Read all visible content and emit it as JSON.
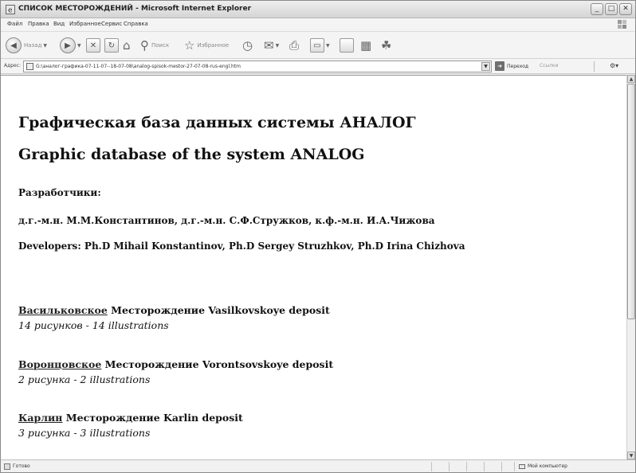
{
  "window": {
    "title": "СПИСОК МЕСТОРОЖДЕНИЙ - Microsoft Internet Explorer"
  },
  "menu": {
    "items": [
      "Файл",
      "Правка",
      "Вид",
      "Избранное",
      "Сервис",
      "Справка"
    ]
  },
  "toolbar": {
    "back_label": "Назад",
    "search_label": "Поиск",
    "favorites_label": "Избранное"
  },
  "address": {
    "label": "Адрес:",
    "url": "G:\\аналог-графика-07-11-07--18-07-08\\analog-spisok-mestor-27-07-08-rus-engl.htm",
    "go_label": "Переход",
    "links_label": "Ссылки"
  },
  "page": {
    "title_ru": "Графическая база данных системы АНАЛОГ",
    "title_en": "Graphic database of the system ANALOG",
    "developers_heading": "Разработчики:",
    "developers_ru": "д.г.-м.н. М.М.Константинов, д.г.-м.н. С.Ф.Стружков, к.ф.-м.н. И.А.Чижова",
    "developers_en": "Developers: Ph.D Mihail Konstantinov, Ph.D Sergey Struzhkov, Ph.D Irina Chizhova",
    "deposits": [
      {
        "link": "Васильковское",
        "text": " Месторождение Vasilkovskoye deposit",
        "count": "14 рисунков - 14 illustrations"
      },
      {
        "link": "Воронцовское",
        "text": " Месторождение Vorontsovskoye deposit",
        "count": "2 рисунка - 2 illustrations"
      },
      {
        "link": "Карлин",
        "text": " Месторождение Karlin deposit",
        "count": "3 рисунка - 3 illustrations"
      }
    ]
  },
  "status": {
    "text": "Готово",
    "zone": "Мой компьютер"
  }
}
